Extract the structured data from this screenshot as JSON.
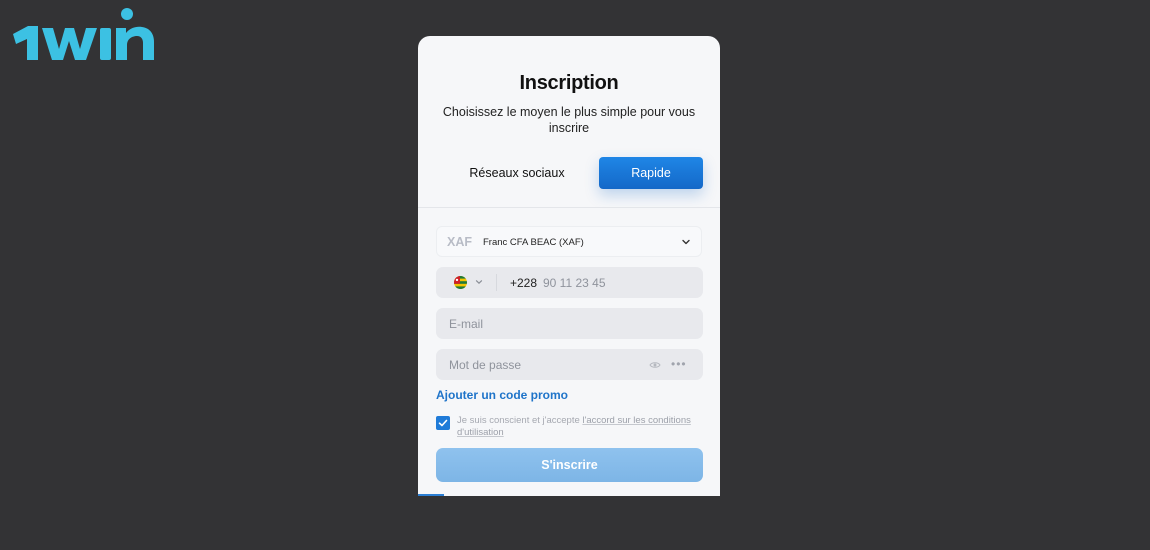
{
  "brand": {
    "logo_text": "1win",
    "logo_color": "#3cc1e3"
  },
  "form": {
    "title": "Inscription",
    "subtitle": "Choisissez le moyen le plus simple pour vous inscrire",
    "tabs": [
      {
        "label": "Réseaux sociaux",
        "active": false
      },
      {
        "label": "Rapide",
        "active": true
      }
    ],
    "currency": {
      "code": "XAF",
      "name": "Franc CFA BEAC (XAF)",
      "icon": "chevron-down-icon"
    },
    "phone": {
      "country_flag": "flag-togo-icon",
      "prefix": "+228",
      "placeholder": "90 11 23 45"
    },
    "email": {
      "placeholder": "E-mail"
    },
    "password": {
      "placeholder": "Mot de passe",
      "masked_dots": "•••"
    },
    "promo_link": "Ajouter un code promo",
    "consent": {
      "checked": true,
      "text_before": "Je suis conscient et j'accepte ",
      "link_text": "l'accord sur les conditions d'utilisation"
    },
    "submit_label": "S'inscrire"
  },
  "colors": {
    "background": "#333335",
    "card": "#f6f7f9",
    "accent": "#1f7bd8",
    "submit_disabled": "#8fc2ee"
  }
}
